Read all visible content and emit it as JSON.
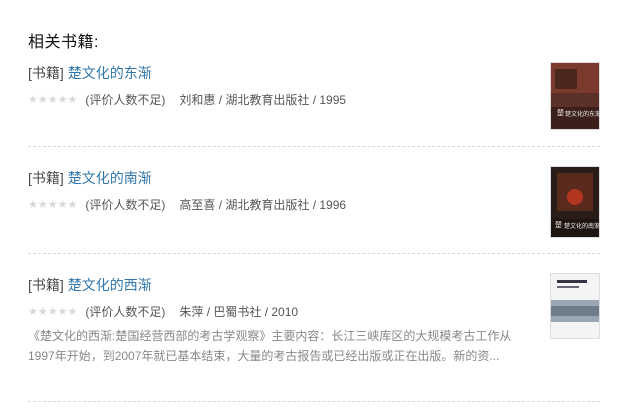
{
  "section": {
    "title": "相关书籍:"
  },
  "books": [
    {
      "tag": "[书籍]",
      "title": "楚文化的东渐",
      "rating_note": "(评价人数不足)",
      "info": "刘和惠 / 湖北教育出版社 / 1995",
      "abstract": "",
      "cover_text": "楚文化的东渐"
    },
    {
      "tag": "[书籍]",
      "title": "楚文化的南渐",
      "rating_note": "(评价人数不足)",
      "info": "高至喜 / 湖北教育出版社 / 1996",
      "abstract": "",
      "cover_text": "楚文化的南渐"
    },
    {
      "tag": "[书籍]",
      "title": "楚文化的西渐",
      "rating_note": "(评价人数不足)",
      "info": "朱萍 / 巴蜀书社 / 2010",
      "abstract": "《楚文化的西渐:楚国经营西部的考古学观察》主要内容：长江三峡库区的大规模考古工作从1997年开始，到2007年就已基本结束，大量的考古报告或已经出版或正在出版。新的资...",
      "cover_text": "楚文化的西渐"
    }
  ],
  "colors": {
    "link": "#3377aa",
    "star_empty": "#d8d8d8",
    "muted": "#888888"
  },
  "icons": {
    "star": "star-icon"
  }
}
